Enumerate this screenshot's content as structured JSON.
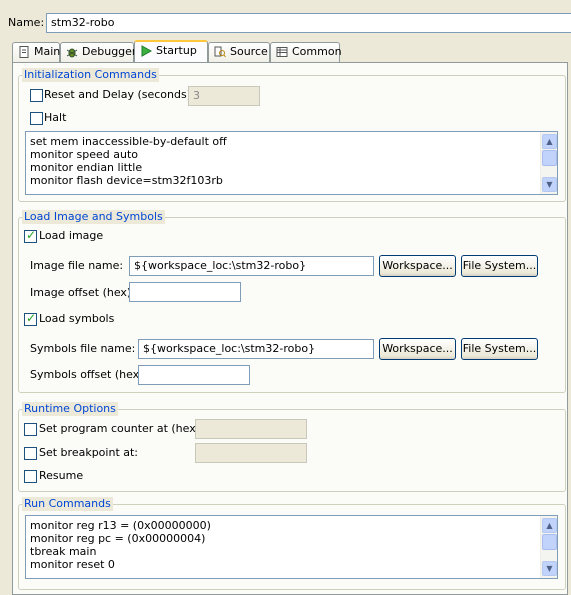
{
  "name": {
    "label": "Name:",
    "value": "stm32-robo"
  },
  "tabs": [
    {
      "label": "Main",
      "icon": "main-page-icon"
    },
    {
      "label": "Debugger",
      "icon": "debugger-bug-icon"
    },
    {
      "label": "Startup",
      "icon": "startup-play-icon",
      "active": true
    },
    {
      "label": "Source",
      "icon": "source-lookup-icon"
    },
    {
      "label": "Common",
      "icon": "common-table-icon"
    }
  ],
  "init": {
    "title": "Initialization Commands",
    "reset_label": "Reset and Delay (seconds):",
    "reset_checked": false,
    "delay_value": "3",
    "halt_label": "Halt",
    "halt_checked": false,
    "commands": [
      "set mem inaccessible-by-default off",
      "monitor speed auto",
      "monitor endian little",
      "monitor flash device=stm32f103rb"
    ]
  },
  "load": {
    "title": "Load Image and Symbols",
    "load_image_label": "Load image",
    "load_image_checked": true,
    "image_file_label": "Image file name:",
    "image_file_value": "${workspace_loc:\\stm32-robo}",
    "image_offset_label": "Image offset (hex):",
    "image_offset_value": "",
    "load_symbols_label": "Load symbols",
    "load_symbols_checked": true,
    "symbols_file_label": "Symbols file name:",
    "symbols_file_value": "${workspace_loc:\\stm32-robo}",
    "symbols_offset_label": "Symbols offset (hex):",
    "symbols_offset_value": "",
    "workspace_button": "Workspace...",
    "filesystem_button": "File System..."
  },
  "runtime": {
    "title": "Runtime Options",
    "pc_label": "Set program counter at (hex):",
    "pc_checked": false,
    "pc_value": "",
    "bp_label": "Set breakpoint at:",
    "bp_checked": false,
    "bp_value": "",
    "resume_label": "Resume",
    "resume_checked": false
  },
  "run": {
    "title": "Run Commands",
    "commands": [
      "monitor reg r13 = (0x00000000)",
      "monitor reg pc = (0x00000004)",
      "tbreak main",
      "monitor reset 0"
    ]
  },
  "colors": {
    "group_title": "#0046d5",
    "tab_active_accent": "#ffc83c",
    "input_border": "#7f9db9",
    "background": "#ece9d8"
  }
}
